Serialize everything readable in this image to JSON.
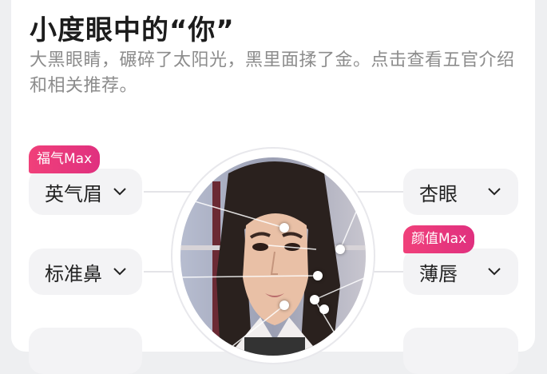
{
  "header": {
    "title": "小度眼中的“你”",
    "description": "大黑眼睛，碾碎了太阳光，黑里面揉了金。点击查看五官介绍和相关推荐。"
  },
  "features": {
    "eyebrow": {
      "label": "英气眉",
      "badge": "福气Max"
    },
    "nose": {
      "label": "标准鼻"
    },
    "eye": {
      "label": "杏眼"
    },
    "lips": {
      "label": "薄唇",
      "badge": "颜值Max"
    }
  },
  "colors": {
    "badge": "#e8357c",
    "pill_bg": "#f3f3f5",
    "text": "#222222"
  },
  "icons": [
    "chevron-down-icon"
  ]
}
